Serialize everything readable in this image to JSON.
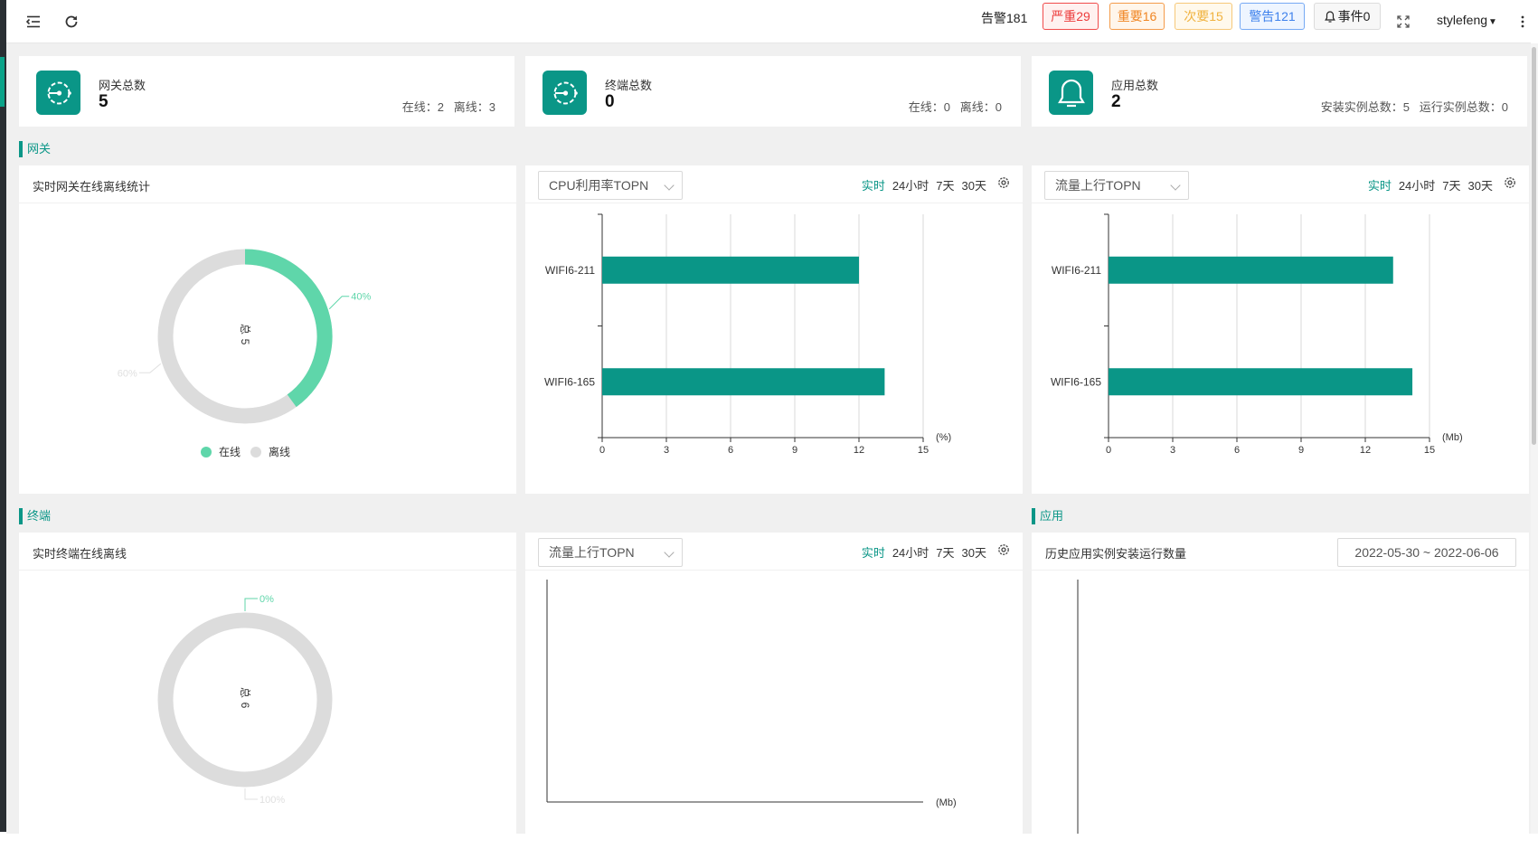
{
  "header": {
    "alarm_total": "告警181",
    "badges": {
      "critical": "严重29",
      "major": "重要16",
      "minor": "次要15",
      "warning": "警告121",
      "events": "事件0"
    },
    "user": "stylefeng"
  },
  "stats": [
    {
      "title": "网关总数",
      "value": "5",
      "sub": "在线：2   离线：3"
    },
    {
      "title": "终端总数",
      "value": "0",
      "sub": "在线：0   离线：0"
    },
    {
      "title": "应用总数",
      "value": "2",
      "sub": "安装实例总数：5   运行实例总数：0"
    }
  ],
  "sections": {
    "gateway": "网关",
    "terminal": "终端",
    "app": "应用"
  },
  "time_tabs": [
    "实时",
    "24小时",
    "7天",
    "30天"
  ],
  "colors": {
    "teal": "#0a9687",
    "online": "#5fd6aa",
    "offline": "#dcdcdc"
  },
  "gateway_donut": {
    "title": "实时网关在线离线统计",
    "center_label": "总",
    "center_value": "5",
    "online_pct_label": "40%",
    "offline_pct_label": "60%",
    "legend": [
      "在线",
      "离线"
    ]
  },
  "cpu_panel": {
    "dropdown": "CPU利用率TOPN"
  },
  "flow_panel": {
    "dropdown": "流量上行TOPN"
  },
  "terminal_donut": {
    "title": "实时终端在线离线",
    "center_label": "总",
    "center_value": "6",
    "online_pct_label": "0%",
    "offline_pct_label": "100%"
  },
  "terminal_flow_panel": {
    "dropdown": "流量上行TOPN"
  },
  "app_history_panel": {
    "title": "历史应用实例安装运行数量",
    "date_range": "2022-05-30 ~ 2022-06-06"
  },
  "chart_data": [
    {
      "type": "pie",
      "categories": [
        "在线",
        "离线"
      ],
      "values": [
        40,
        60
      ]
    },
    {
      "type": "bar",
      "orientation": "horizontal",
      "categories": [
        "WIFI6-211",
        "WIFI6-165"
      ],
      "values": [
        12,
        13.2
      ],
      "xlabel": "(%)",
      "xlim": [
        0,
        15
      ],
      "xticks": [
        0,
        3,
        6,
        9,
        12,
        15
      ],
      "grid": true
    },
    {
      "type": "bar",
      "orientation": "horizontal",
      "categories": [
        "WIFI6-211",
        "WIFI6-165"
      ],
      "values": [
        13.3,
        14.2
      ],
      "xlabel": "(Mb)",
      "xlim": [
        0,
        15
      ],
      "xticks": [
        0,
        3,
        6,
        9,
        12,
        15
      ],
      "grid": true
    },
    {
      "type": "pie",
      "categories": [
        "在线",
        "离线"
      ],
      "values": [
        0,
        100
      ]
    },
    {
      "type": "bar",
      "orientation": "horizontal",
      "categories": [],
      "values": [],
      "xlabel": "(Mb)"
    }
  ]
}
